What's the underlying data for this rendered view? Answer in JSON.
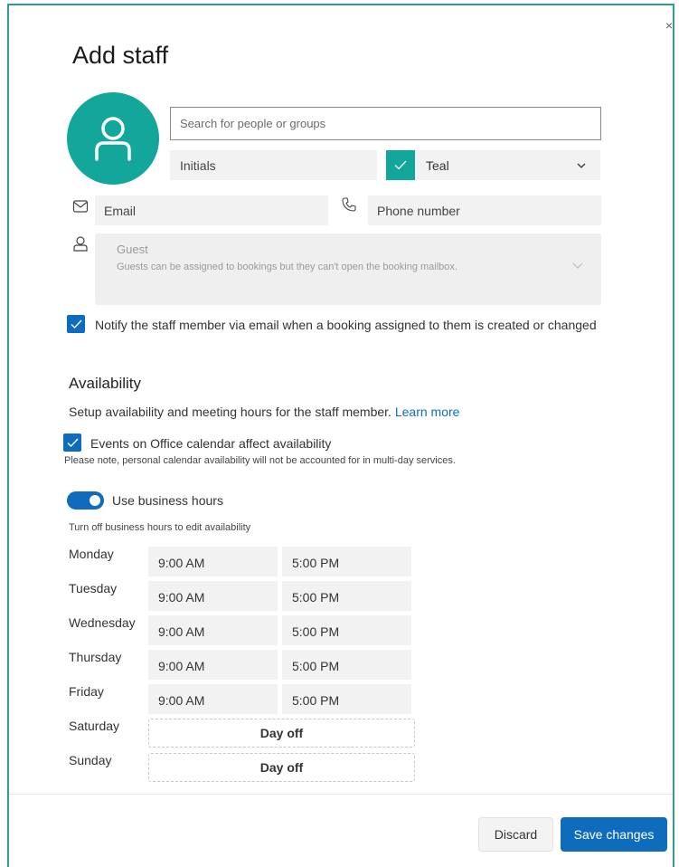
{
  "dialog": {
    "title": "Add staff",
    "close_glyph": "×"
  },
  "form": {
    "search_placeholder": "Search for people or groups",
    "initials_placeholder": "Initials",
    "color_value": "Teal",
    "email_placeholder": "Email",
    "phone_placeholder": "Phone number",
    "role_value": "Guest",
    "role_description": "Guests can be assigned to bookings but they can't open the booking mailbox.",
    "notify_label": "Notify the staff member via email when a booking assigned to them is created or changed",
    "notify_checked": true
  },
  "availability": {
    "heading": "Availability",
    "description": "Setup availability and meeting hours for the staff member.",
    "learn_more": "Learn more",
    "events_label": "Events on Office calendar affect availability",
    "events_checked": true,
    "note": "Please note, personal calendar availability will not be accounted for in multi-day services.",
    "business_hours_label": "Use business hours",
    "business_hours_on": true,
    "business_hours_note": "Turn off business hours to edit availability",
    "days": [
      {
        "name": "Monday",
        "start": "9:00 AM",
        "end": "5:00 PM"
      },
      {
        "name": "Tuesday",
        "start": "9:00 AM",
        "end": "5:00 PM"
      },
      {
        "name": "Wednesday",
        "start": "9:00 AM",
        "end": "5:00 PM"
      },
      {
        "name": "Thursday",
        "start": "9:00 AM",
        "end": "5:00 PM"
      },
      {
        "name": "Friday",
        "start": "9:00 AM",
        "end": "5:00 PM"
      },
      {
        "name": "Saturday",
        "off": "Day off"
      },
      {
        "name": "Sunday",
        "off": "Day off"
      }
    ]
  },
  "footer": {
    "discard_label": "Discard",
    "save_label": "Save changes"
  },
  "colors": {
    "accent": "#0f6cbd",
    "avatar_teal": "#13a69b",
    "frame_border": "#2f9c8c"
  },
  "icons": [
    "person-icon",
    "check-icon",
    "chevron-down-icon",
    "mail-icon",
    "phone-icon",
    "role-person-icon"
  ]
}
